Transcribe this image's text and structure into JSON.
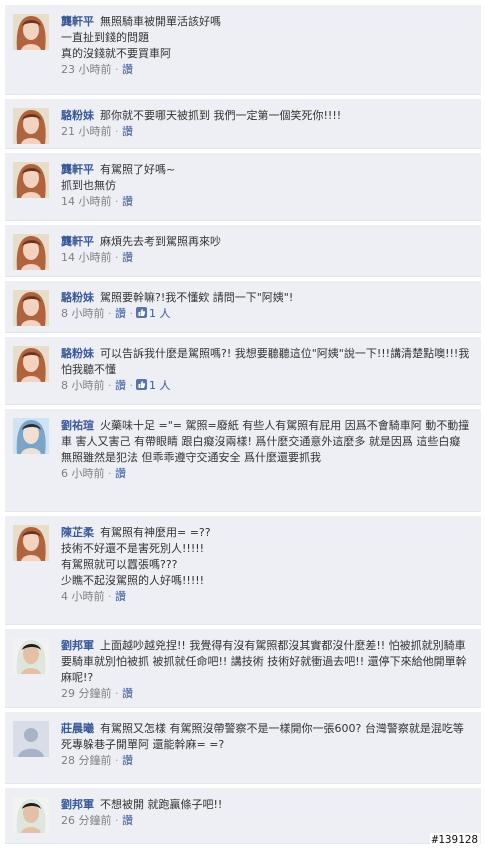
{
  "comments": [
    {
      "author": "龔軒平",
      "avatar": "female-photo-avatar",
      "text": "無照騎車被開單活該好嗎\n一直扯到錢的問題\n真的沒錢就不要買車阿",
      "time": "23 小時前",
      "sep": "·",
      "like": "讚"
    },
    {
      "author": "駱粉妹",
      "avatar": "female-photo-avatar",
      "text": "那你就不要哪天被抓到 我們一定第一個笑死你!!!!",
      "time": "21 小時前",
      "sep": "·",
      "like": "讚"
    },
    {
      "author": "龔軒平",
      "avatar": "female-photo-avatar",
      "text": "有駕照了好嗎~\n抓到也無仿",
      "time": "14 小時前",
      "sep": "·",
      "like": "讚"
    },
    {
      "author": "龔軒平",
      "avatar": "female-photo-avatar",
      "text": "麻煩先去考到駕照再來吵",
      "time": "14 小時前",
      "sep": "·",
      "like": "讚"
    },
    {
      "author": "駱粉妹",
      "avatar": "female-photo-avatar",
      "text": "駕照要幹嘛?!我不懂欸 請問一下\"阿姨\"!",
      "time": "8 小時前",
      "sep": "·",
      "like": "讚",
      "like_count": "1 人"
    },
    {
      "author": "駱粉妹",
      "avatar": "female-photo-avatar",
      "text": "可以告訴我什麼是駕照嗎?! 我想要聽聽這位\"阿姨\"說一下!!!講清楚點噢!!!我怕我聽不懂",
      "time": "8 小時前",
      "sep": "·",
      "like": "讚",
      "like_count": "1 人"
    },
    {
      "author": "劉祐瑄",
      "avatar": "photo-avatar",
      "text": "火藥味十足 =\"= 駕照=廢紙 有些人有駕照有屁用 因爲不會騎車阿 動不動撞車 害人又害己 有帶眼睛 跟白癡沒兩樣! 爲什麼交通意外這麼多 就是因爲 這些白癡 無照雖然是犯法 但乖乖遵守交通安全 爲什麼還要抓我",
      "time": "6 小時前",
      "sep": "·",
      "like": "讚"
    },
    {
      "author": "陳芷柔",
      "avatar": "female-photo-avatar",
      "text": "有駕照有神麼用= =??\n技術不好還不是害死別人!!!!!\n有駕照就可以囂張嗎???\n少瞧不起沒駕照的人好嗎!!!!!",
      "time": "4 小時前",
      "sep": "·",
      "like": "讚"
    },
    {
      "author": "劉邦軍",
      "avatar": "male-photo-avatar",
      "text": "上面越吵越兇捏!! 我覺得有沒有駕照都沒其實都沒什麼差!! 怕被抓就別騎車 要騎車就別怕被抓 被抓就任命吧!! 講技術 技術好就衝過去吧!! 還停下來給他開單幹麻呢!?",
      "time": "29 分鐘前",
      "sep": "·",
      "like": "讚"
    },
    {
      "author": "莊晨曦",
      "avatar": "default-silhouette-avatar",
      "text": "有駕照又怎樣 有駕照沒帶警察不是一樣開你一張600? 台灣警察就是混吃等死專躲巷子開單阿 還能幹麻= =?",
      "time": "28 分鐘前",
      "sep": "·",
      "like": "讚"
    },
    {
      "author": "劉邦軍",
      "avatar": "male-photo-avatar",
      "text": "不想被開 就跑贏條子吧!!",
      "time": "26 分鐘前",
      "sep": "·",
      "like": "讚"
    }
  ],
  "icons": {
    "like": "thumbs-up-icon"
  },
  "colors": {
    "background": "#edeff4",
    "author": "#3b5998",
    "meta": "#808080"
  },
  "watermark": "#139128"
}
